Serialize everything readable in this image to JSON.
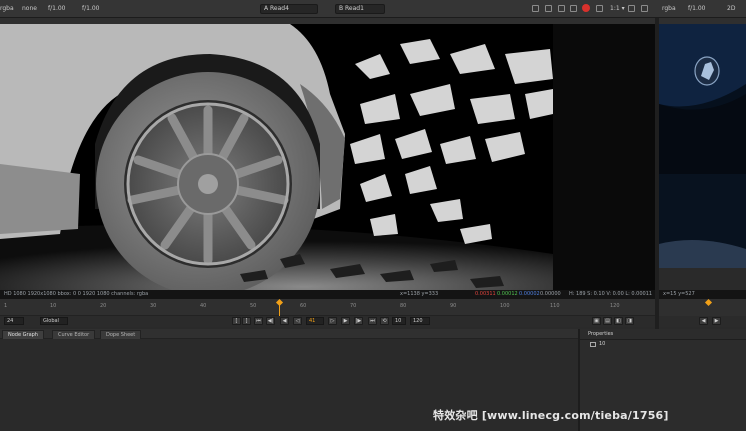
{
  "topbar": {
    "channel_left": "rgba",
    "layer_left": "none",
    "gain_left": "f/1.00",
    "input_a": "A  Read4",
    "input_b": "B  Read1",
    "frame_right": "1:1 ▾",
    "channel_right": "rgba",
    "gain_right": "f/1.00",
    "zoom_right": "2D"
  },
  "viewer1": {
    "info_left": "HD 1080 1920x1080 bbox: 0 0 1920 1080 channels: rgba",
    "info_cursor": "x=1138 y=333",
    "info_r": "0.00311",
    "info_g": "0.00012",
    "info_b": "0.00002",
    "info_a": "0.00000",
    "info_hsv": "H: 189 S: 0.10 V: 0.00  L: 0.00011"
  },
  "viewer2": {
    "info": "x=15 y=527"
  },
  "timeline": {
    "ticks": [
      "1",
      "10",
      "20",
      "30",
      "40",
      "50",
      "60",
      "70",
      "80",
      "90",
      "100",
      "110",
      "120"
    ],
    "current_frame": "41"
  },
  "transport": {
    "fps": "24",
    "mode": "Global",
    "frame_field": "41",
    "inc_field": "10",
    "end_field": "120"
  },
  "tabs": [
    "Node Graph",
    "Curve Editor",
    "Dope Sheet"
  ],
  "properties": {
    "title": "Properties",
    "node_count": "10"
  },
  "watermark": "特效杂吧  [www.linecg.com/tieba/1756]",
  "colors": {
    "accent": "#f0a018",
    "record": "#d8312c",
    "panel_bg": "#2a2a2a",
    "viewer_bg": "#000000"
  }
}
